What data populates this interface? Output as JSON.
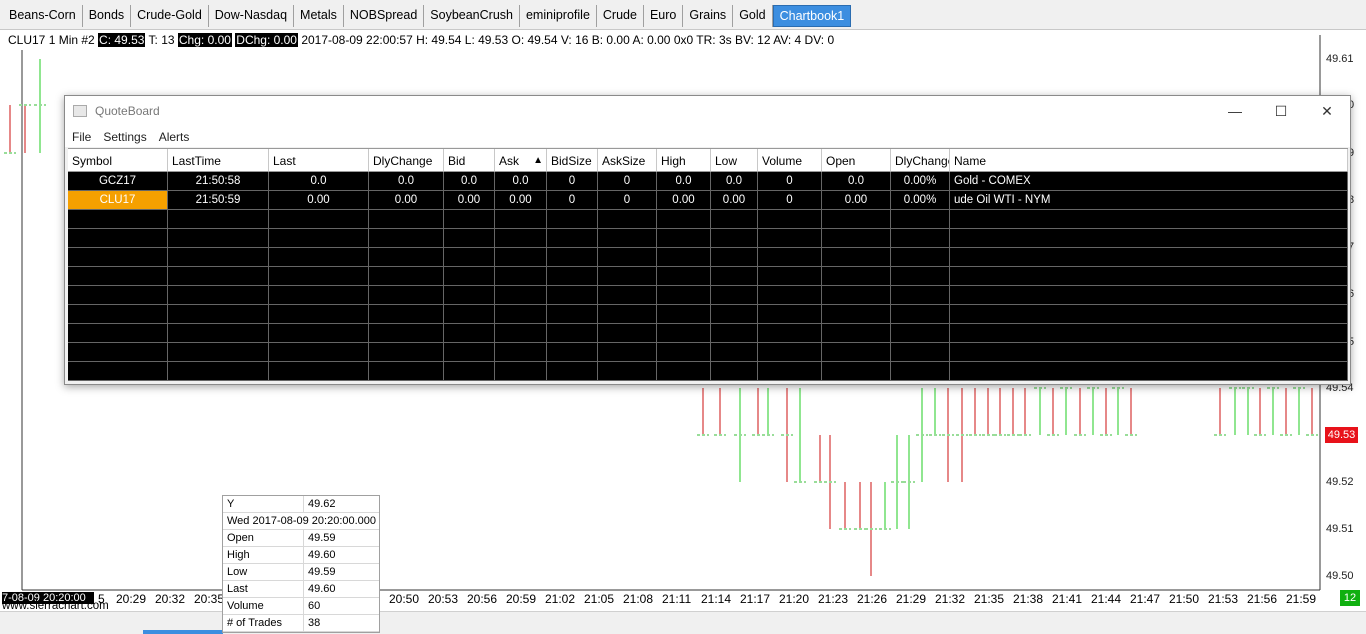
{
  "tabs": [
    "Beans-Corn",
    "Bonds",
    "Crude-Gold",
    "Dow-Nasdaq",
    "Metals",
    "NOBSpread",
    "SoybeanCrush",
    "eminiprofile",
    "Crude",
    "Euro",
    "Grains",
    "Gold",
    "Chartbook1"
  ],
  "active_tab": "Chartbook1",
  "infobar": {
    "prefix": "CLU17  1 Min  #2 ",
    "c": "C: 49.53",
    "t": " T: 13 ",
    "chg": "Chg: 0.00",
    "dchg": "DChg: 0.00",
    "rest": " 2017-08-09 22:00:57 H: 49.54 L: 49.53 O: 49.54 V: 16 B: 0.00 A: 0.00 0x0 TR: 3s BV: 12 AV: 4 DV: 0"
  },
  "price_axis": [
    "49.61",
    "0",
    "9",
    "8",
    "7",
    "6",
    "5",
    "49.54",
    "49.52",
    "49.51",
    "49.50"
  ],
  "last_price": "49.53",
  "time_axis": [
    "7-08-09  20:20:00",
    "5",
    "20:29",
    "20:32",
    "20:35",
    "20:50",
    "20:53",
    "20:56",
    "20:59",
    "21:02",
    "21:05",
    "21:08",
    "21:11",
    "21:14",
    "21:17",
    "21:20",
    "21:23",
    "21:26",
    "21:29",
    "21:32",
    "21:35",
    "21:38",
    "21:41",
    "21:44",
    "21:47",
    "21:50",
    "21:53",
    "21:56",
    "21:59"
  ],
  "bottom_badge": "12",
  "watermark": "www.sierrachart.com",
  "data_window": {
    "y_label": "Y",
    "y_value": "49.62",
    "datetime": "Wed 2017-08-09  20:20:00.000",
    "rows": [
      {
        "k": "Open",
        "v": "49.59"
      },
      {
        "k": "High",
        "v": "49.60"
      },
      {
        "k": "Low",
        "v": "49.59"
      },
      {
        "k": "Last",
        "v": "49.60"
      },
      {
        "k": "Volume",
        "v": "60"
      },
      {
        "k": "# of Trades",
        "v": "38"
      }
    ]
  },
  "quoteboard": {
    "title": "QuoteBoard",
    "menu": [
      "File",
      "Settings",
      "Alerts"
    ],
    "columns": [
      "Symbol",
      "LastTime",
      "Last",
      "DlyChange",
      "Bid",
      "Ask",
      "BidSize",
      "AskSize",
      "High",
      "Low",
      "Volume",
      "Open",
      "DlyChange",
      "Name"
    ],
    "rows": [
      [
        "GCZ17",
        "21:50:58",
        "0.0",
        "0.0",
        "0.0",
        "0.0",
        "0",
        "0",
        "0.0",
        "0.0",
        "0",
        "0.0",
        "0.00%",
        "Gold - COMEX"
      ],
      [
        "CLU17",
        "21:50:59",
        "0.00",
        "0.00",
        "0.00",
        "0.00",
        "0",
        "0",
        "0.00",
        "0.00",
        "0",
        "0.00",
        "0.00%",
        "ude Oil WTI - NYM"
      ]
    ],
    "selected_symbol": "CLU17"
  },
  "colors": {
    "up": "#22cc22",
    "down": "#cc1111",
    "accent": "#3c8ee0",
    "selected": "#f5a000"
  }
}
